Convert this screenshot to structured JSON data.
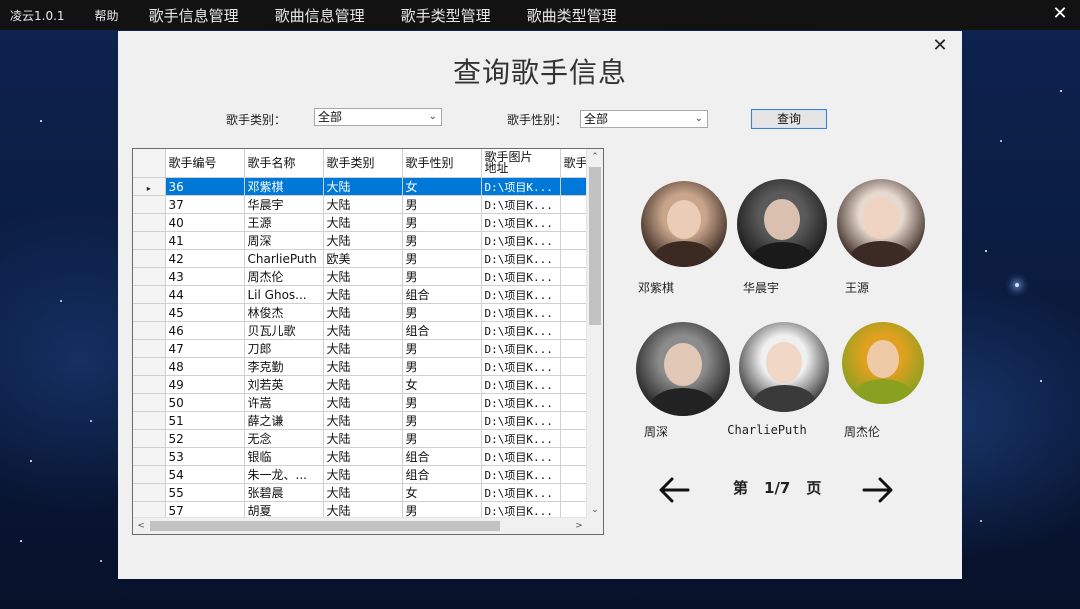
{
  "app": {
    "version": "凌云1.0.1",
    "help": "帮助"
  },
  "menu": [
    "歌手信息管理",
    "歌曲信息管理",
    "歌手类型管理",
    "歌曲类型管理"
  ],
  "window": {
    "close": "✕"
  },
  "panel": {
    "title": "查询歌手信息",
    "close": "✕"
  },
  "filters": {
    "type_label": "歌手类别：",
    "type_value": "全部",
    "gender_label": "歌手性别：",
    "gender_value": "全部",
    "query_button": "查询"
  },
  "table": {
    "columns": [
      "歌手编号",
      "歌手名称",
      "歌手类别",
      "歌手性别",
      "歌手图片\n地址",
      "歌手"
    ],
    "rows": [
      [
        "36",
        "邓紫棋",
        "大陆",
        "女",
        "D:\\项目K..."
      ],
      [
        "37",
        "华晨宇",
        "大陆",
        "男",
        "D:\\项目K..."
      ],
      [
        "40",
        "王源",
        "大陆",
        "男",
        "D:\\项目K..."
      ],
      [
        "41",
        "周深",
        "大陆",
        "男",
        "D:\\项目K..."
      ],
      [
        "42",
        "CharliePuth",
        "欧美",
        "男",
        "D:\\项目K..."
      ],
      [
        "43",
        "周杰伦",
        "大陆",
        "男",
        "D:\\项目K..."
      ],
      [
        "44",
        "Lil Ghos...",
        "大陆",
        "组合",
        "D:\\项目K..."
      ],
      [
        "45",
        "林俊杰",
        "大陆",
        "男",
        "D:\\项目K..."
      ],
      [
        "46",
        "贝瓦儿歌",
        "大陆",
        "组合",
        "D:\\项目K..."
      ],
      [
        "47",
        "刀郎",
        "大陆",
        "男",
        "D:\\项目K..."
      ],
      [
        "48",
        "李克勤",
        "大陆",
        "男",
        "D:\\项目K..."
      ],
      [
        "49",
        "刘若英",
        "大陆",
        "女",
        "D:\\项目K..."
      ],
      [
        "50",
        "许嵩",
        "大陆",
        "男",
        "D:\\项目K..."
      ],
      [
        "51",
        "薛之谦",
        "大陆",
        "男",
        "D:\\项目K..."
      ],
      [
        "52",
        "无念",
        "大陆",
        "男",
        "D:\\项目K..."
      ],
      [
        "53",
        "银临",
        "大陆",
        "组合",
        "D:\\项目K..."
      ],
      [
        "54",
        "朱一龙、...",
        "大陆",
        "组合",
        "D:\\项目K..."
      ],
      [
        "55",
        "张碧晨",
        "大陆",
        "女",
        "D:\\项目K..."
      ],
      [
        "57",
        "胡夏",
        "大陆",
        "男",
        "D:\\项目K..."
      ]
    ],
    "selected_row": 0
  },
  "singers": [
    {
      "name": "邓紫棋",
      "color1": "#c9a58c",
      "color2": "#3a2a22"
    },
    {
      "name": "华晨宇",
      "color1": "#5a5a5a",
      "color2": "#1a1a1a"
    },
    {
      "name": "王源",
      "color1": "#e8d9cf",
      "color2": "#3b2b24"
    },
    {
      "name": "周深",
      "color1": "#8c8c8c",
      "color2": "#222222"
    },
    {
      "name": "CharliePuth",
      "color1": "#f0f0f0",
      "color2": "#3a3a3a"
    },
    {
      "name": "周杰伦",
      "color1": "#e0a020",
      "color2": "#8aa020"
    }
  ],
  "pager": {
    "prefix": "第",
    "page": "1/7",
    "suffix": "页",
    "current": 1,
    "total": 7
  },
  "colors": {
    "selection": "#0078d7",
    "accent_border": "#3c7fd6"
  }
}
